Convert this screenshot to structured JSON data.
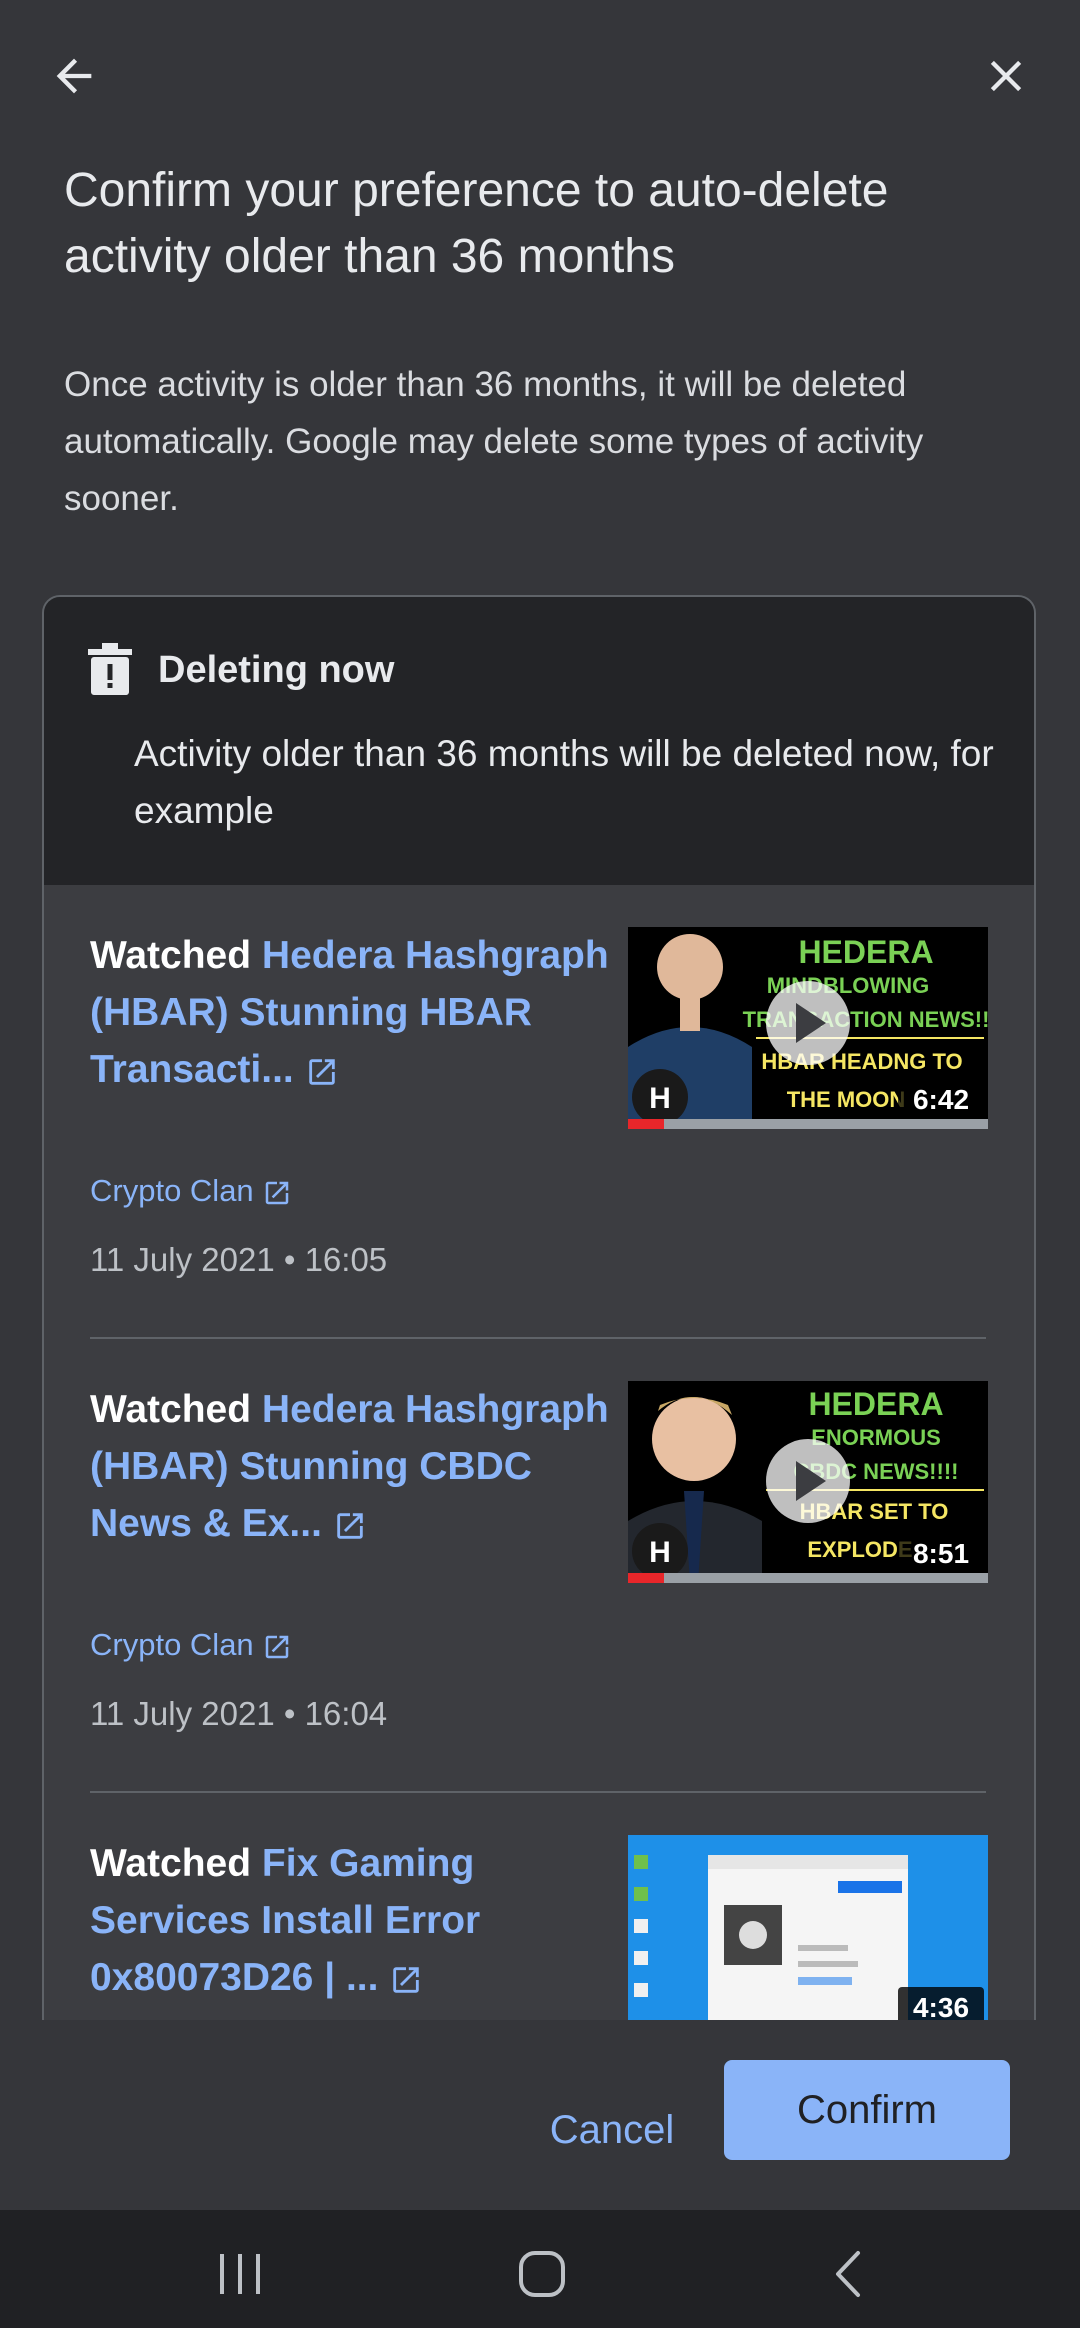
{
  "header": {
    "title": "Confirm your preference to auto-delete activity older than 36 months",
    "description": "Once activity is older than 36 months, it will be deleted automatically. Google may delete some types of activity sooner."
  },
  "deleting": {
    "title": "Deleting now",
    "subtitle": "Activity older than 36 months will be deleted now, for example"
  },
  "entries": [
    {
      "prefix": "Watched",
      "title": "Hedera Hashgraph (HBAR) Stunning HBAR Transacti...",
      "channel": "Crypto Clan",
      "date": "11 July 2021 • 16:05",
      "duration": "6:42",
      "progress": 0.1,
      "thumb_lines": [
        "HEDERA",
        "MINDBLOWING",
        "TRANSACTION NEWS!!",
        "HBAR HEADNG TO",
        "THE MOON"
      ]
    },
    {
      "prefix": "Watched",
      "title": "Hedera Hashgraph (HBAR) Stunning CBDC News & Ex...",
      "channel": "Crypto Clan",
      "date": "11 July 2021 • 16:04",
      "duration": "8:51",
      "progress": 0.1,
      "thumb_lines": [
        "HEDERA",
        "ENORMOUS",
        "CBDC NEWS!!!!",
        "HBAR SET TO",
        "EXPLODE"
      ]
    },
    {
      "prefix": "Watched",
      "title": "Fix Gaming Services Install Error 0x80073D26 | ...",
      "duration": "4:36"
    }
  ],
  "footer": {
    "cancel": "Cancel",
    "confirm": "Confirm"
  },
  "colors": {
    "accent": "#8ab4f8",
    "thumb_green": "#7ad155",
    "thumb_yellow": "#f5e663",
    "progress_red": "#e8262a"
  }
}
